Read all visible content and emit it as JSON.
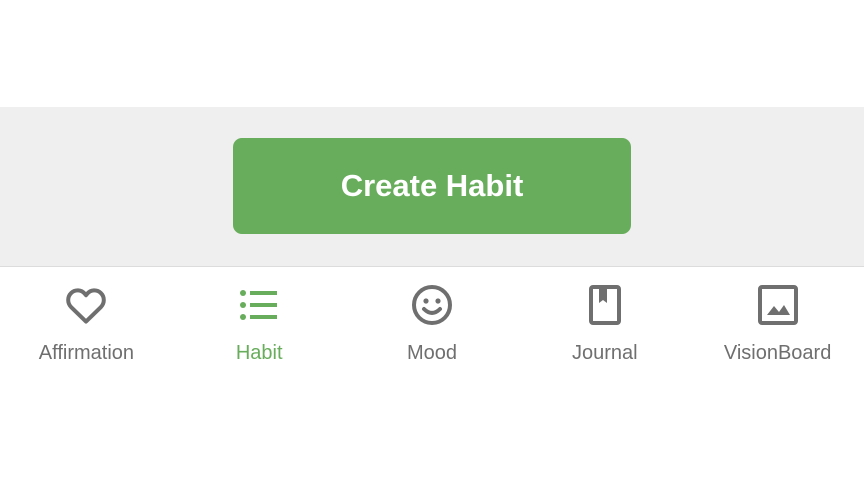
{
  "create_button": {
    "label": "Create Habit",
    "color": "#67ad5b"
  },
  "bottom_nav": {
    "active_color": "#67ad5b",
    "inactive_color": "#6f6f6f",
    "items": [
      {
        "label": "Affirmation",
        "icon": "heart-outline-icon",
        "active": false
      },
      {
        "label": "Habit",
        "icon": "list-icon",
        "active": true
      },
      {
        "label": "Mood",
        "icon": "smiley-face-icon",
        "active": false
      },
      {
        "label": "Journal",
        "icon": "bookmark-book-icon",
        "active": false
      },
      {
        "label": "VisionBoard",
        "icon": "image-icon",
        "active": false
      }
    ]
  }
}
